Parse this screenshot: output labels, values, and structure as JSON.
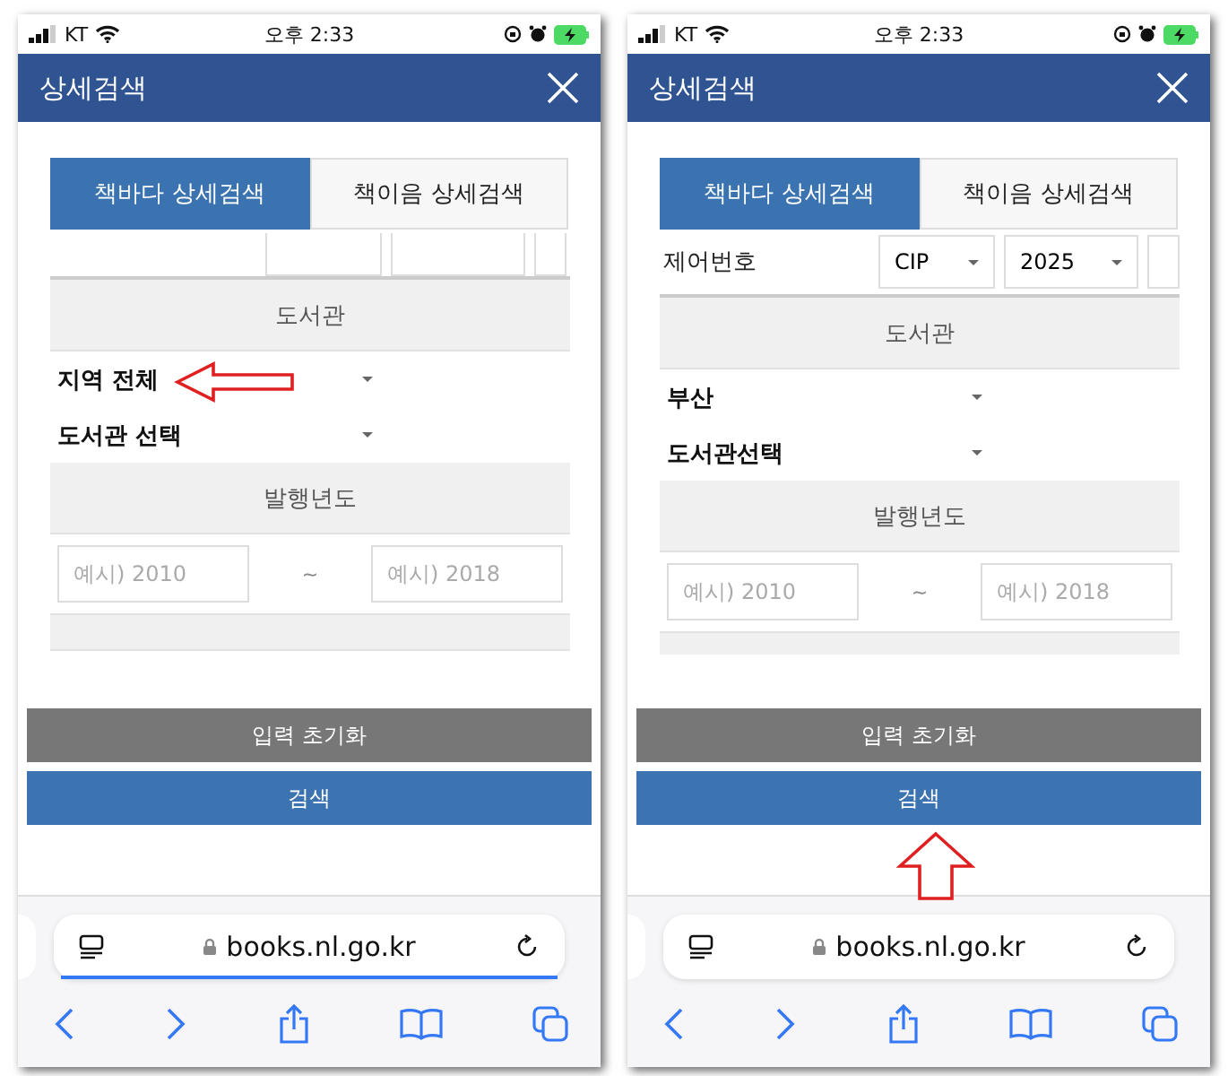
{
  "phones": [
    {
      "status": {
        "carrier": "KT",
        "time": "오후 2:33"
      },
      "title": "상세검색",
      "tabs": [
        {
          "label": "책바다 상세검색",
          "selected": true
        },
        {
          "label": "책이음 상세검색",
          "selected": false
        }
      ],
      "control_row": {
        "scrolled_off": true
      },
      "sections": [
        {
          "kind": "header",
          "label": "도서관"
        },
        {
          "kind": "select",
          "value": "지역 전체"
        },
        {
          "kind": "select",
          "value": "도서관 선택"
        },
        {
          "kind": "header",
          "label": "발행년도"
        },
        {
          "kind": "range",
          "from_placeholder": "예시) 2010",
          "separator": "~",
          "to_placeholder": "예시) 2018"
        },
        {
          "kind": "header-cut"
        }
      ],
      "buttons": [
        {
          "kind": "reset",
          "label": "입력 초기화"
        },
        {
          "kind": "search",
          "label": "검색"
        }
      ],
      "browser": {
        "url": "books.nl.go.kr",
        "loading_bar": true
      },
      "annotation": {
        "kind": "arrow-left"
      }
    },
    {
      "status": {
        "carrier": "KT",
        "time": "오후 2:33"
      },
      "title": "상세검색",
      "tabs": [
        {
          "label": "책바다 상세검색",
          "selected": true
        },
        {
          "label": "책이음 상세검색",
          "selected": false
        }
      ],
      "control_row": {
        "scrolled_off": false,
        "label": "제어번호",
        "selects": [
          {
            "value": "CIP"
          },
          {
            "value": "2025"
          }
        ]
      },
      "sections": [
        {
          "kind": "header",
          "label": "도서관"
        },
        {
          "kind": "select",
          "value": "부산"
        },
        {
          "kind": "select",
          "value": "도서관선택"
        },
        {
          "kind": "header",
          "label": "발행년도"
        },
        {
          "kind": "range",
          "from_placeholder": "예시) 2010",
          "separator": "~",
          "to_placeholder": "예시) 2018"
        },
        {
          "kind": "header-cut"
        }
      ],
      "buttons": [
        {
          "kind": "reset",
          "label": "입력 초기화"
        },
        {
          "kind": "search",
          "label": "검색"
        }
      ],
      "browser": {
        "url": "books.nl.go.kr",
        "loading_bar": false
      },
      "annotation": {
        "kind": "arrow-up"
      }
    }
  ]
}
